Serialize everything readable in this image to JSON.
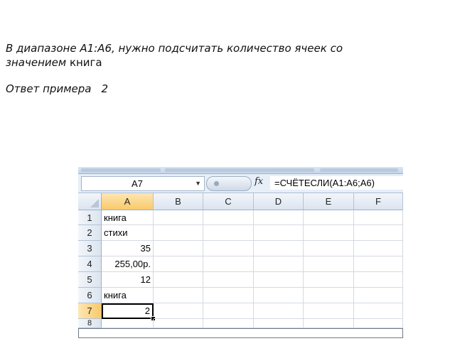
{
  "task": {
    "line1": "В диапазоне А1:А6, нужно подсчитать количество ячеек со",
    "line2_italic": "значением",
    "line2_word": " книга"
  },
  "answer": {
    "label": "Ответ примера",
    "value": "2"
  },
  "excel": {
    "name_box": "A7",
    "fx_label": "fx",
    "formula": "=СЧЁТЕСЛИ(A1:A6;A6)",
    "columns": [
      "A",
      "B",
      "C",
      "D",
      "E",
      "F"
    ],
    "rows": [
      "1",
      "2",
      "3",
      "4",
      "5",
      "6",
      "7",
      "8"
    ],
    "cells": {
      "A1": "книга",
      "A2": "стихи",
      "A3": "35",
      "A4": "255,00р.",
      "A5": "12",
      "A6": "книга",
      "A7": "2"
    },
    "selected_cell": "A7"
  }
}
